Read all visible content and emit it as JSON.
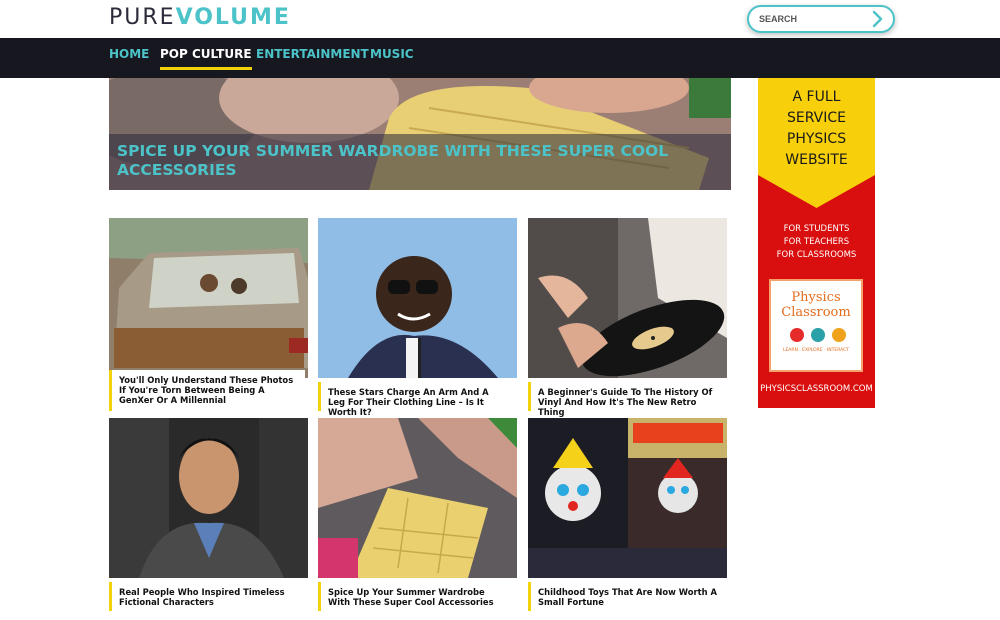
{
  "header": {
    "logo_part1": "PURE",
    "logo_part2": "VOLUME",
    "search_placeholder": "SEARCH"
  },
  "nav": {
    "items": [
      "HOME",
      "POP CULTURE",
      "ENTERTAINMENT",
      "MUSIC"
    ],
    "active": "POP CULTURE"
  },
  "hero": {
    "title": "SPICE UP YOUR SUMMER WARDROBE WITH THESE SUPER COOL ACCESSORIES"
  },
  "articles": [
    {
      "title": "You'll Only Understand These Photos If You're Torn Between Being A GenXer Or A Millennial"
    },
    {
      "title": "These Stars Charge An Arm And A Leg For Their Clothing Line – Is It Worth It?"
    },
    {
      "title": "A Beginner's Guide To The History Of Vinyl And How It's The New Retro Thing"
    },
    {
      "title": "Real People Who Inspired Timeless Fictional Characters"
    },
    {
      "title": "Spice Up Your Summer Wardrobe With These Super Cool Accessories"
    },
    {
      "title": "Childhood Toys That Are Now Worth A Small Fortune"
    }
  ],
  "ad": {
    "headline": [
      "A FULL",
      "SERVICE",
      "PHYSICS",
      "WEBSITE"
    ],
    "audiences": [
      "FOR STUDENTS",
      "FOR TEACHERS",
      "FOR CLASSROOMS"
    ],
    "brand_line1": "Physics",
    "brand_line2": "Classroom",
    "brand_tagline": "LEARN · EXPLORE · INTERACT",
    "url": "PHYSICSCLASSROOM.COM"
  },
  "colors": {
    "accent": "#4cc3c8",
    "nav_bg": "#17171f",
    "underline": "#f2d20a",
    "ad_red": "#d90e0e",
    "ad_yellow": "#f7cf0a"
  }
}
